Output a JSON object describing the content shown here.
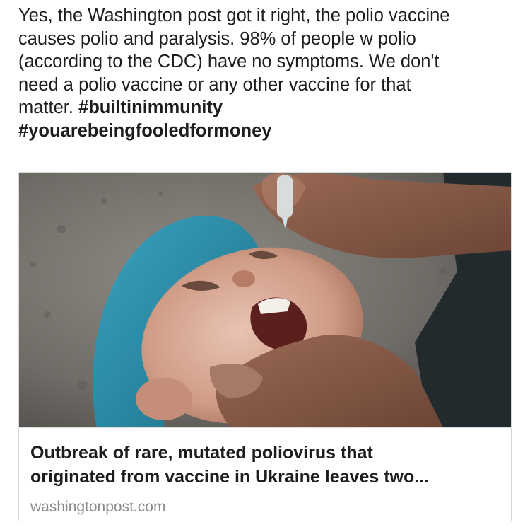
{
  "post": {
    "text_lines": [
      "Yes, the Washington post got it right, the polio vaccine",
      "causes polio and paralysis. 98% of people w polio",
      "(according to the CDC) have no symptoms. We don't",
      "need a polio vaccine or any other vaccine for that",
      "matter."
    ],
    "hashtags": [
      "#builtinimmunity",
      "#youarebeingfooledformoney"
    ]
  },
  "link_card": {
    "image_alt": "child receiving oral polio vaccine drops",
    "title_lines": [
      "Outbreak of rare, mutated poliovirus that",
      "originated from vaccine in Ukraine leaves two..."
    ],
    "domain": "washingtonpost.com"
  }
}
